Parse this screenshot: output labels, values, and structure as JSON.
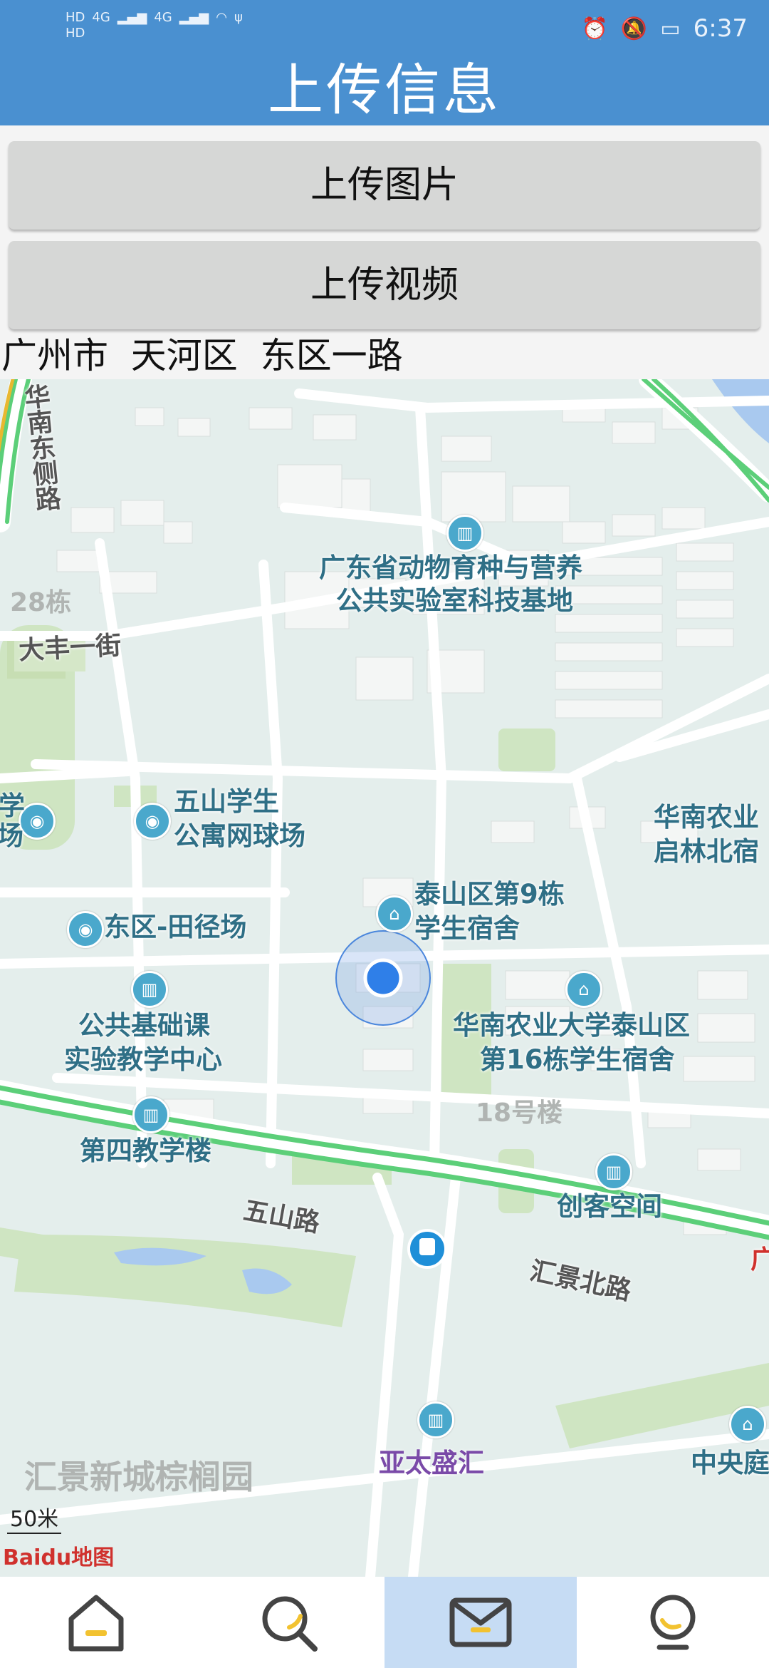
{
  "status_bar": {
    "left_icons": [
      "HD1",
      "HD2",
      "4G signal",
      "4G signal",
      "wifi-icon",
      "usb-icon"
    ],
    "hd1": "HD",
    "hd2": "HD",
    "net1": "4G",
    "net2": "4G",
    "time": "6:37"
  },
  "header": {
    "title": "上传信息"
  },
  "actions": {
    "upload_image": "上传图片",
    "upload_video": "上传视频"
  },
  "address": {
    "city": "广州市",
    "district": "天河区",
    "road": "东区一路"
  },
  "map": {
    "labels": {
      "poi_lab": "广东省动物育种与营养",
      "poi_lab2": "公共实验室科技基地",
      "poi_tennis": "五山学生",
      "poi_tennis2": "公寓网球场",
      "poi_track": "东区-田径场",
      "poi_dorm9": "泰山区第9栋",
      "poi_dorm9b": "学生宿舍",
      "poi_basic": "公共基础课",
      "poi_basic2": "实验教学中心",
      "poi_dorm16": "华南农业大学泰山区",
      "poi_dorm16b": "第16栋学生宿舍",
      "poi_teach4": "第四教学楼",
      "poi_maker": "创客空间",
      "poi_scau": "华南农业",
      "poi_scau2": "启林北宿",
      "poi_yatai": "亚太盛汇",
      "poi_central": "中央庭",
      "area_huijing": "汇景新城棕榈园",
      "faded_28": "28栋",
      "faded_18": "18号楼",
      "road_dafeng": "大丰一街",
      "road_wushan": "五山路",
      "road_huijing": "汇景北路",
      "road_hnd": "华南东侧路",
      "edge_xue": "学",
      "edge_chang": "场",
      "edge_guang": "广"
    },
    "scale": "50米",
    "logo": "Baidu地图",
    "location_color": "#2f7fe8"
  },
  "bottom_nav": {
    "items": [
      "home-icon",
      "search-icon",
      "mail-icon",
      "lightbulb-icon"
    ],
    "active_index": 2,
    "accent": "#f2c230"
  }
}
